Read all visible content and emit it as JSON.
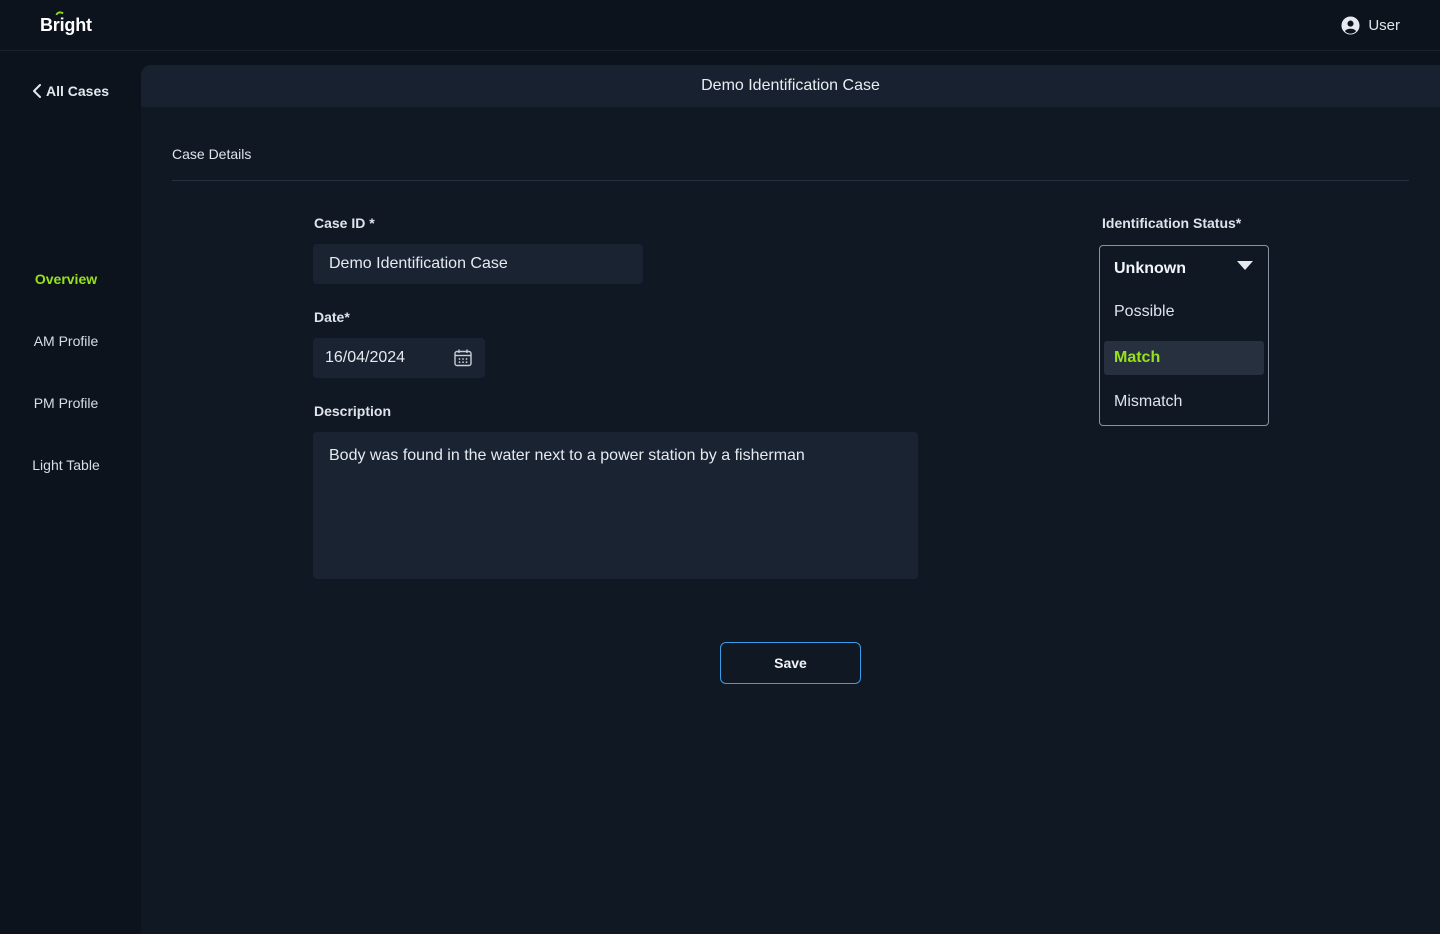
{
  "app": {
    "logo": "Bright"
  },
  "user": {
    "label": "User",
    "icon": "user-circle-icon"
  },
  "sidebar": {
    "back_label": "All Cases",
    "items": [
      {
        "label": "Overview",
        "active": true
      },
      {
        "label": "AM Profile",
        "active": false
      },
      {
        "label": "PM Profile",
        "active": false
      },
      {
        "label": "Light Table",
        "active": false
      }
    ]
  },
  "header": {
    "title": "Demo Identification Case"
  },
  "section": {
    "title": "Case Details"
  },
  "form": {
    "case_id": {
      "label": "Case ID *",
      "value": "Demo Identification Case"
    },
    "date": {
      "label": "Date*",
      "value": "16/04/2024"
    },
    "description": {
      "label": "Description",
      "value": "Body was found in the water next to a power station by a fisherman"
    },
    "save_label": "Save"
  },
  "status": {
    "label": "Identification Status*",
    "selected": "Unknown",
    "options": [
      "Possible",
      "Match",
      "Mismatch"
    ],
    "highlighted": "Match"
  },
  "colors": {
    "accent": "#97e21b",
    "button_border": "#3a9be6",
    "background": "#0d131d",
    "panel": "#101824"
  }
}
